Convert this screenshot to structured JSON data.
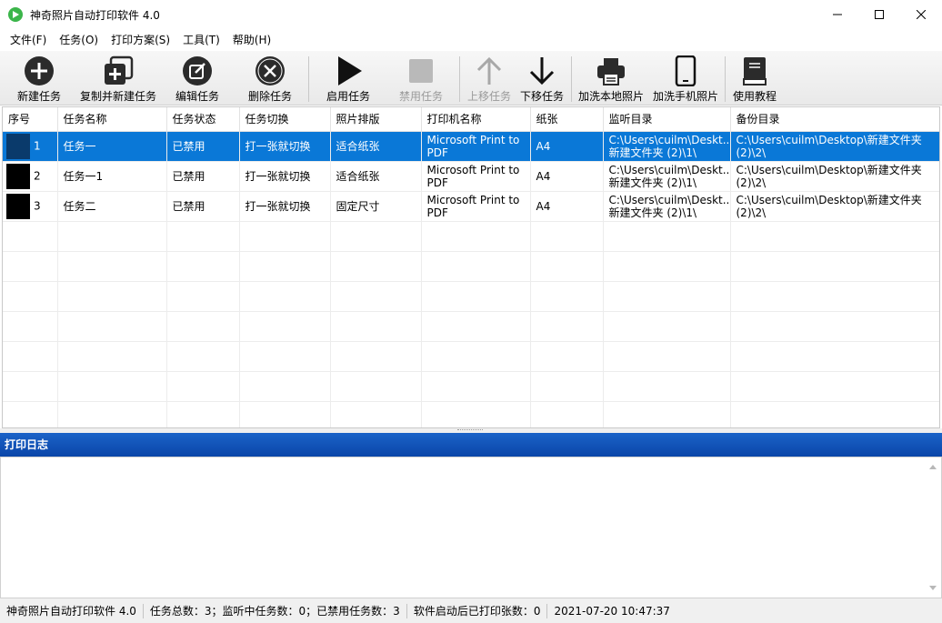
{
  "window": {
    "title": "神奇照片自动打印软件 4.0",
    "minimize": "—",
    "maximize": "☐",
    "close": "✕"
  },
  "menu": [
    "文件(F)",
    "任务(O)",
    "打印方案(S)",
    "工具(T)",
    "帮助(H)"
  ],
  "toolbar": {
    "new": "新建任务",
    "copy_new": "复制并新建任务",
    "edit": "编辑任务",
    "delete": "删除任务",
    "enable": "启用任务",
    "disable": "禁用任务",
    "move_up": "上移任务",
    "move_down": "下移任务",
    "add_local": "加洗本地照片",
    "add_phone": "加洗手机照片",
    "tutorial": "使用教程"
  },
  "table": {
    "headers": [
      "序号",
      "任务名称",
      "任务状态",
      "任务切换",
      "照片排版",
      "打印机名称",
      "纸张",
      "监听目录",
      "备份目录"
    ],
    "rows": [
      {
        "seq": "1",
        "name": "任务一",
        "status": "已禁用",
        "switch": "打一张就切换",
        "layout": "适合纸张",
        "printer": "Microsoft Print to PDF",
        "paper": "A4",
        "watch": "C:\\Users\\cuilm\\Deskt... 新建文件夹 (2)\\1\\",
        "backup": "C:\\Users\\cuilm\\Desktop\\新建文件夹 (2)\\2\\"
      },
      {
        "seq": "2",
        "name": "任务一1",
        "status": "已禁用",
        "switch": "打一张就切换",
        "layout": "适合纸张",
        "printer": "Microsoft Print to PDF",
        "paper": "A4",
        "watch": "C:\\Users\\cuilm\\Deskt... 新建文件夹 (2)\\1\\",
        "backup": "C:\\Users\\cuilm\\Desktop\\新建文件夹 (2)\\2\\"
      },
      {
        "seq": "3",
        "name": "任务二",
        "status": "已禁用",
        "switch": "打一张就切换",
        "layout": "固定尺寸",
        "printer": "Microsoft Print to PDF",
        "paper": "A4",
        "watch": "C:\\Users\\cuilm\\Deskt... 新建文件夹 (2)\\1\\",
        "backup": "C:\\Users\\cuilm\\Desktop\\新建文件夹 (2)\\2\\"
      }
    ]
  },
  "log": {
    "title": "打印日志"
  },
  "status": {
    "app": "神奇照片自动打印软件 4.0",
    "counts": "任务总数：3；监听中任务数：0；已禁用任务数：3",
    "printed": "软件启动后已打印张数：0",
    "datetime": "2021-07-20 10:47:37"
  },
  "colors": {
    "selection": "#0a78d7",
    "log_header": "#1557bf"
  }
}
